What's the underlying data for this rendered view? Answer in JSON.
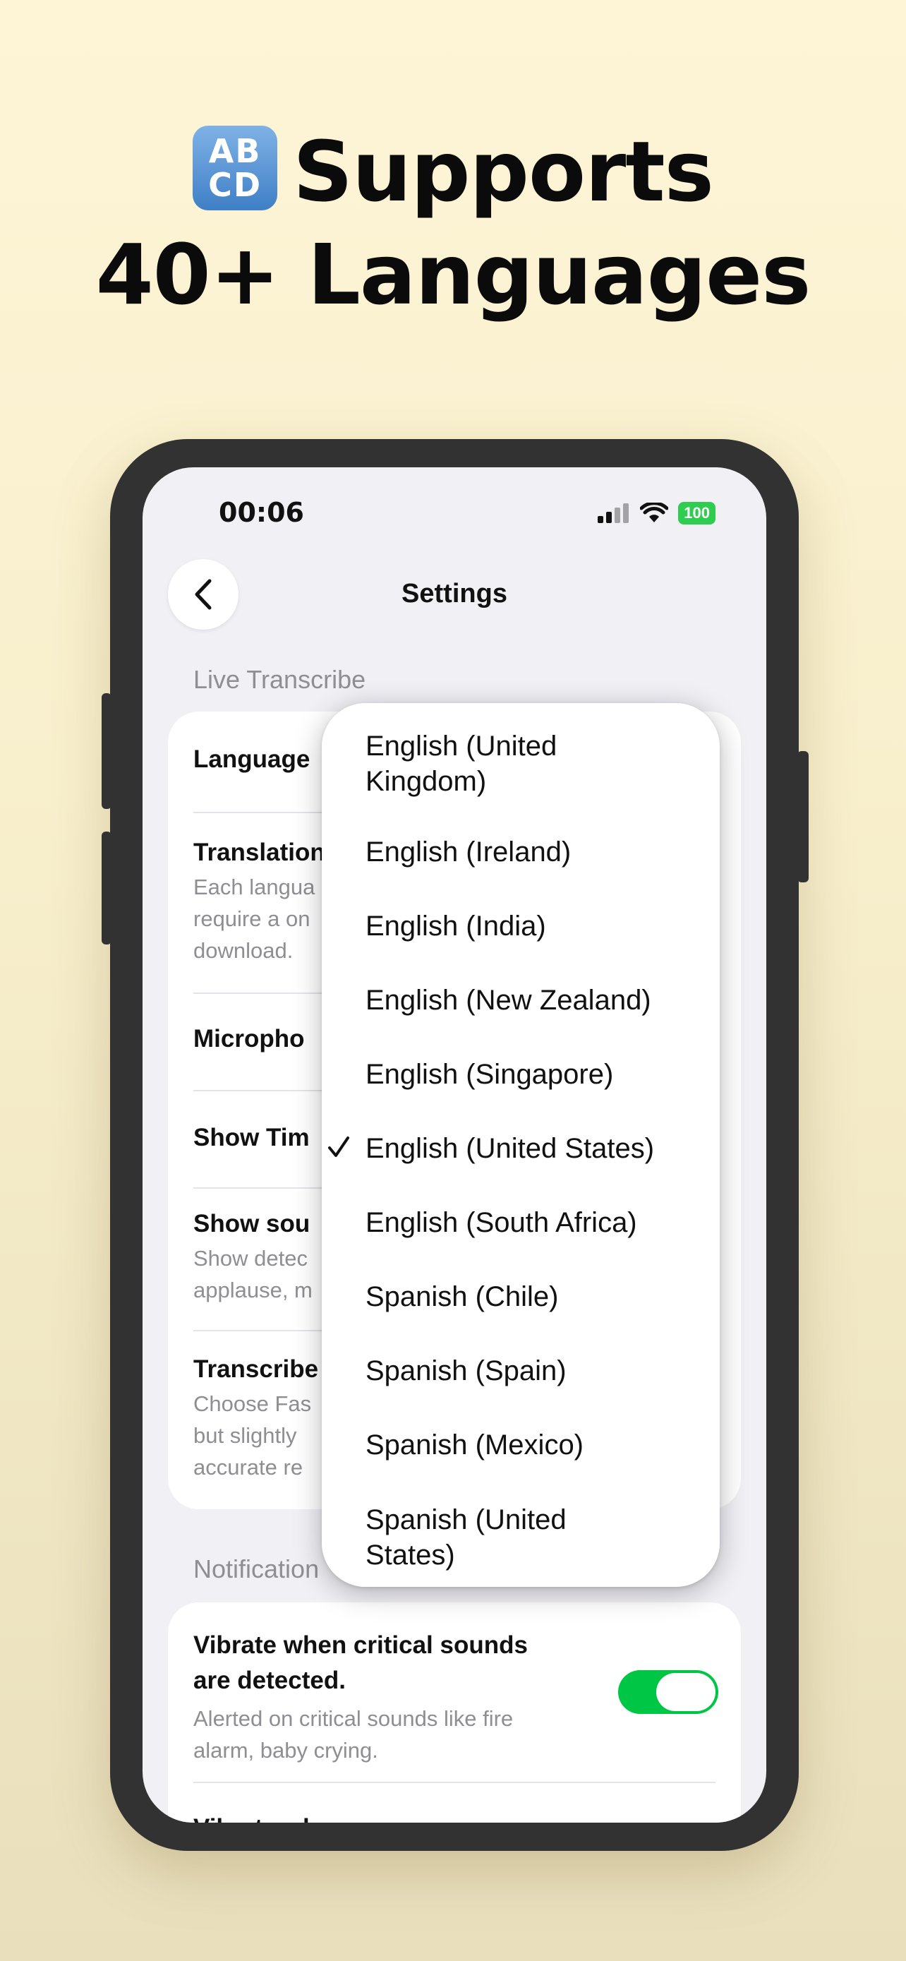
{
  "headline": {
    "line1": "Supports",
    "line2": "40+ Languages",
    "icon": "input-latin-letters-icon",
    "icon_text_top": "AB",
    "icon_text_bottom": "CD"
  },
  "status_bar": {
    "time": "00:06",
    "battery": "100",
    "battery_color": "#2fcd4f"
  },
  "nav": {
    "title": "Settings",
    "back_icon": "chevron-left-icon"
  },
  "live_transcribe": {
    "header": "Live Transcribe",
    "language_label": "Language",
    "translation": {
      "title": "Translation",
      "sub": [
        "Each langua",
        "require a on",
        "download."
      ]
    },
    "microphone_label": "Micropho",
    "show_time_label": "Show Tim",
    "show_sounds": {
      "title": "Show sou",
      "sub": [
        "Show detec",
        "applause, m"
      ]
    },
    "transcribe": {
      "title": "Transcribe",
      "sub": [
        "Choose Fas",
        "but slightly",
        "accurate re"
      ]
    }
  },
  "notification": {
    "header": "Notification",
    "vibrate": {
      "title": [
        "Vibrate when critical sounds",
        "are detected."
      ],
      "sub": [
        "Alerted on critical sounds like fire",
        "alarm, baby crying."
      ],
      "toggle_on": true
    },
    "next_row_partial": "Vibrate when"
  },
  "language_menu": {
    "selected_index": 5,
    "items": [
      [
        "English (United",
        "Kingdom)"
      ],
      [
        "English (Ireland)"
      ],
      [
        "English (India)"
      ],
      [
        "English (New Zealand)"
      ],
      [
        "English (Singapore)"
      ],
      [
        "English (United States)"
      ],
      [
        "English (South Africa)"
      ],
      [
        "Spanish (Chile)"
      ],
      [
        "Spanish (Spain)"
      ],
      [
        "Spanish (Mexico)"
      ],
      [
        "Spanish (United",
        "States)"
      ]
    ]
  },
  "colors": {
    "accent_green": "#00c646",
    "background": "#fdf5d6",
    "phone_frame": "#323232"
  }
}
